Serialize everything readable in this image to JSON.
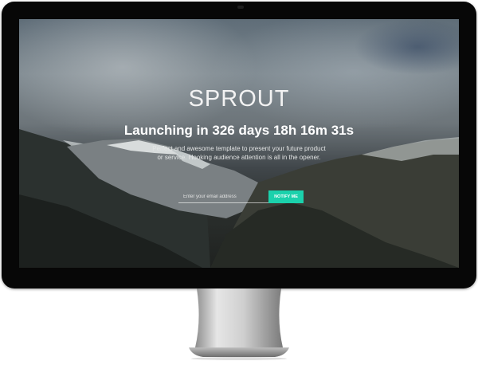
{
  "hero": {
    "title": "SPROUT",
    "countdown": "Launching in 326 days 18h 16m 31s",
    "description": "Perfect and awesome template to present your future product or service. Hooking audience attention is all in the opener."
  },
  "signup": {
    "email_placeholder": "Enter your email address",
    "button_label": "NOTIFY ME"
  },
  "colors": {
    "accent": "#1bd1ac",
    "bezel": "#070707",
    "stand": "#c8c8c8"
  }
}
